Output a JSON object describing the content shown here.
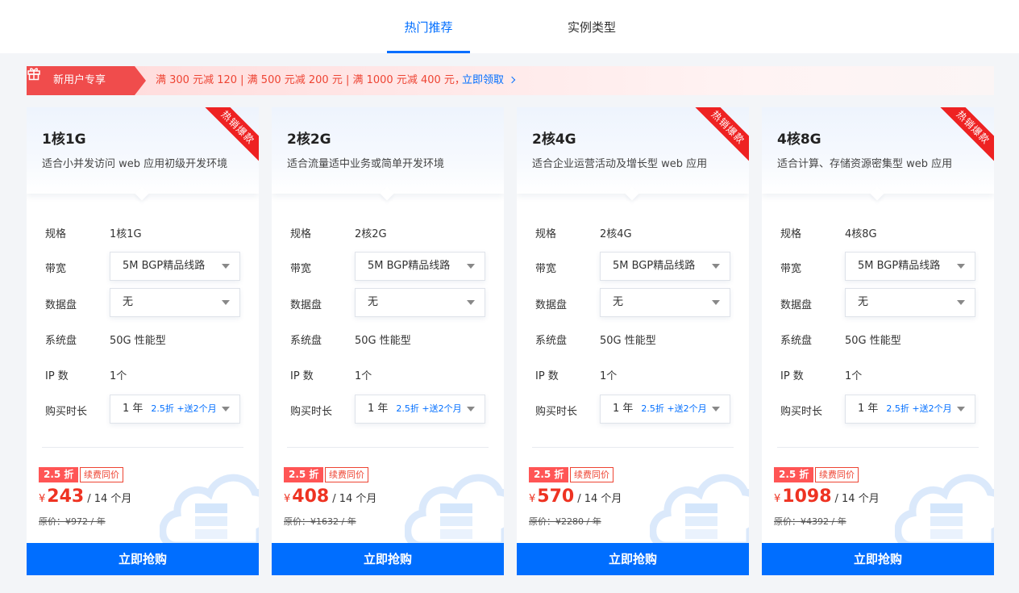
{
  "tabs": [
    {
      "label": "热门推荐",
      "active": true
    },
    {
      "label": "实例类型",
      "active": false
    }
  ],
  "banner": {
    "tag_label": "新用户专享",
    "offer_text": "满 300 元减 120 | 满 500 元减 200 元 | 满 1000 元减 400 元，",
    "link_text": "立即领取",
    "icon": "gift-icon"
  },
  "cards": [
    {
      "title": "1核1G",
      "desc": "适合小并发访问 web 应用初级开发环境",
      "ribbon": "热销爆款",
      "spec_label": "规格",
      "spec_value": "1核1G",
      "bandwidth_label": "带宽",
      "bandwidth_value": "5M BGP精品线路",
      "disk_label": "数据盘",
      "disk_value": "无",
      "sysdisk_label": "系统盘",
      "sysdisk_value": "50G 性能型",
      "ip_label": "IP 数",
      "ip_value": "1个",
      "duration_label": "购买时长",
      "duration_value": "1 年",
      "duration_promo": "2.5折 +送2个月",
      "discount": "2.5 折",
      "renew": "续费同价",
      "currency": "¥",
      "price": "243",
      "period": "/ 14 个月",
      "orig_price": "原价：¥972 / 年",
      "buy_label": "立即抢购"
    },
    {
      "title": "2核2G",
      "desc": "适合流量适中业务或简单开发环境",
      "ribbon": "",
      "spec_label": "规格",
      "spec_value": "2核2G",
      "bandwidth_label": "带宽",
      "bandwidth_value": "5M BGP精品线路",
      "disk_label": "数据盘",
      "disk_value": "无",
      "sysdisk_label": "系统盘",
      "sysdisk_value": "50G 性能型",
      "ip_label": "IP 数",
      "ip_value": "1个",
      "duration_label": "购买时长",
      "duration_value": "1 年",
      "duration_promo": "2.5折 +送2个月",
      "discount": "2.5 折",
      "renew": "续费同价",
      "currency": "¥",
      "price": "408",
      "period": "/ 14 个月",
      "orig_price": "原价：¥1632 / 年",
      "buy_label": "立即抢购"
    },
    {
      "title": "2核4G",
      "desc": "适合企业运营活动及增长型 web 应用",
      "ribbon": "热销爆款",
      "spec_label": "规格",
      "spec_value": "2核4G",
      "bandwidth_label": "带宽",
      "bandwidth_value": "5M BGP精品线路",
      "disk_label": "数据盘",
      "disk_value": "无",
      "sysdisk_label": "系统盘",
      "sysdisk_value": "50G 性能型",
      "ip_label": "IP 数",
      "ip_value": "1个",
      "duration_label": "购买时长",
      "duration_value": "1 年",
      "duration_promo": "2.5折 +送2个月",
      "discount": "2.5 折",
      "renew": "续费同价",
      "currency": "¥",
      "price": "570",
      "period": "/ 14 个月",
      "orig_price": "原价：¥2280 / 年",
      "buy_label": "立即抢购"
    },
    {
      "title": "4核8G",
      "desc": "适合计算、存储资源密集型 web 应用",
      "ribbon": "热销爆款",
      "spec_label": "规格",
      "spec_value": "4核8G",
      "bandwidth_label": "带宽",
      "bandwidth_value": "5M BGP精品线路",
      "disk_label": "数据盘",
      "disk_value": "无",
      "sysdisk_label": "系统盘",
      "sysdisk_value": "50G 性能型",
      "ip_label": "IP 数",
      "ip_value": "1个",
      "duration_label": "购买时长",
      "duration_value": "1 年",
      "duration_promo": "2.5折 +送2个月",
      "discount": "2.5 折",
      "renew": "续费同价",
      "currency": "¥",
      "price": "1098",
      "period": "/ 14 个月",
      "orig_price": "原价：¥4392 / 年",
      "buy_label": "立即抢购"
    }
  ],
  "colors": {
    "accent": "#006eff",
    "sale_red": "#ee3322",
    "page_bg": "#f3f5f8"
  }
}
